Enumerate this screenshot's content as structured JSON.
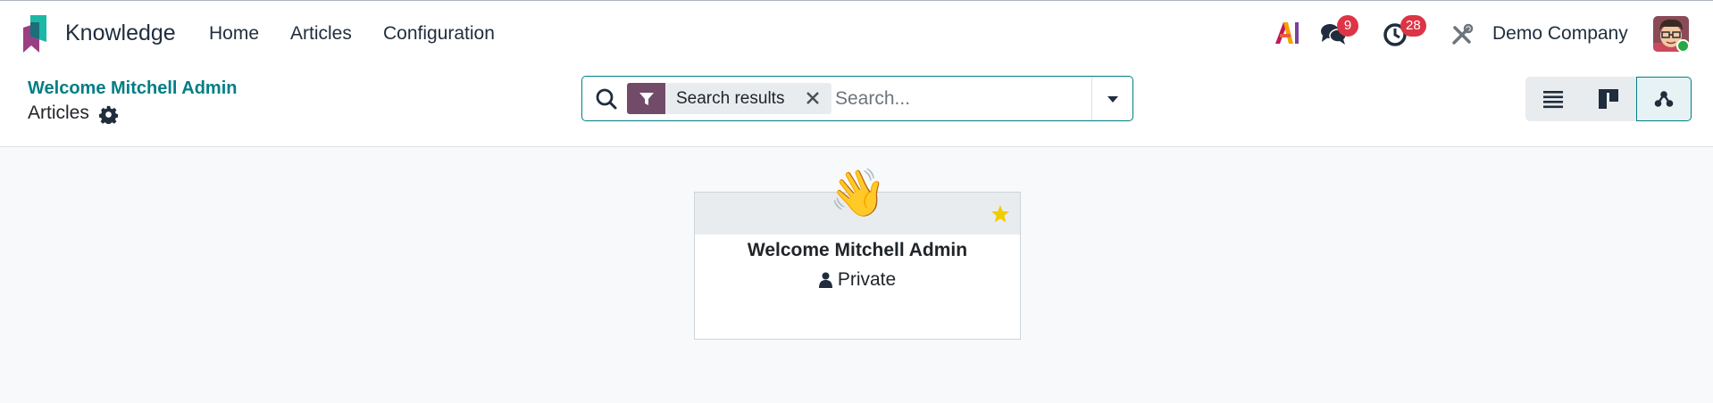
{
  "app": {
    "name": "Knowledge"
  },
  "nav": {
    "home": "Home",
    "articles": "Articles",
    "configuration": "Configuration"
  },
  "systray": {
    "messages_count": "9",
    "activities_count": "28",
    "company": "Demo Company"
  },
  "breadcrumb": {
    "parent": "Welcome Mitchell Admin",
    "current": "Articles"
  },
  "search": {
    "facet_label": "Search results",
    "placeholder": "Search..."
  },
  "views": [
    "list",
    "kanban",
    "hierarchy"
  ],
  "active_view": "hierarchy",
  "card": {
    "emoji": "👋",
    "title": "Welcome Mitchell Admin",
    "privacy": "Private",
    "favorite": true
  },
  "colors": {
    "brand_purple": "#714b67",
    "accent_teal": "#017e84",
    "badge_red": "#dc3545",
    "star_yellow": "#f3cc00"
  }
}
